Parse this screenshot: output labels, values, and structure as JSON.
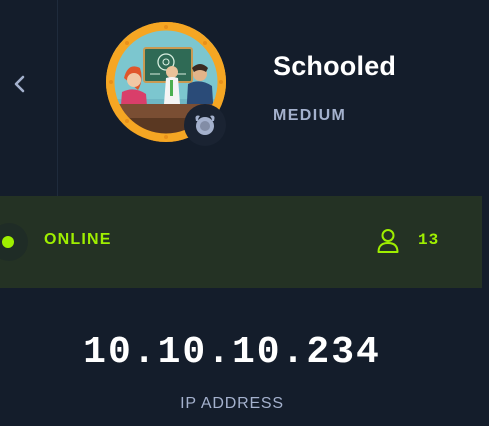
{
  "machine": {
    "name": "Schooled",
    "difficulty": "MEDIUM",
    "os_icon": "freebsd-icon",
    "avatar_icon": "schooled-classroom-avatar"
  },
  "navigation": {
    "back_icon": "chevron-left-icon"
  },
  "status": {
    "label": "ONLINE",
    "users_count": "13",
    "users_icon": "user-icon"
  },
  "network": {
    "ip": "10.10.10.234",
    "ip_label": "IP ADDRESS"
  },
  "colors": {
    "background": "#141d2b",
    "status_bar": "#243224",
    "accent_green": "#9fef00",
    "muted_text": "#a4b1cd",
    "avatar_ring": "#f5a623"
  }
}
